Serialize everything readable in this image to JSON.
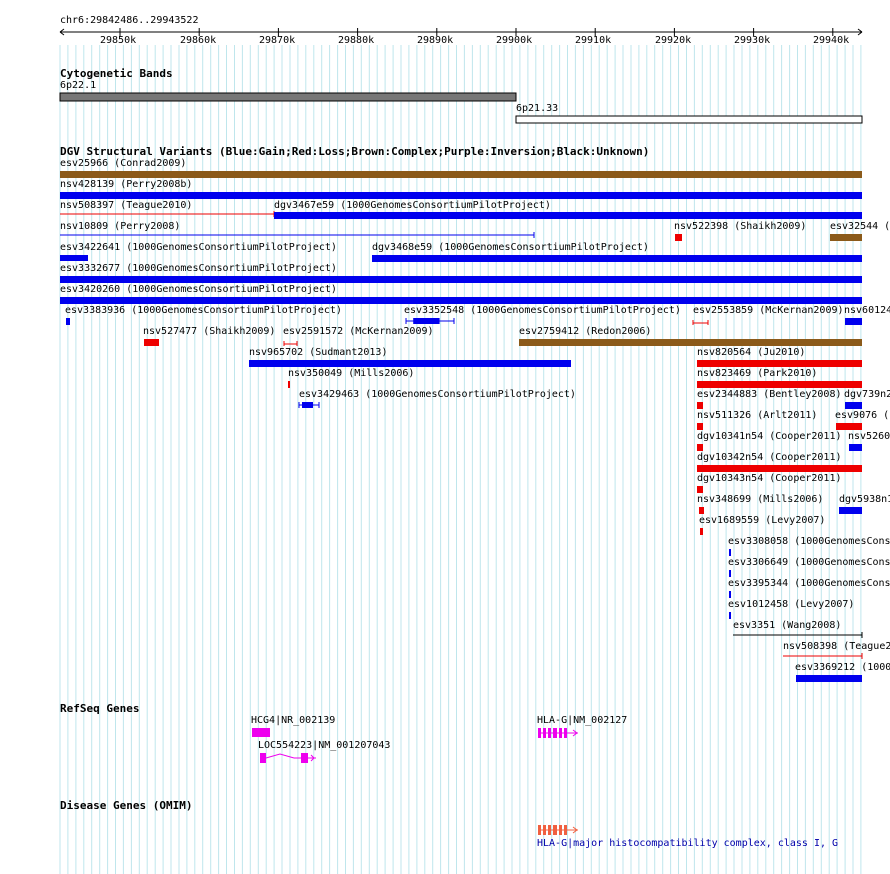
{
  "ruler": {
    "title": "chr6:29842486..29943522",
    "ticks": [
      "29850k",
      "29860k",
      "29870k",
      "29880k",
      "29890k",
      "29900k",
      "29910k",
      "29920k",
      "29930k",
      "29940k"
    ]
  },
  "tracks": {
    "cytoband": "Cytogenetic Bands",
    "dgv": "DGV Structural Variants (Blue:Gain;Red:Loss;Brown:Complex;Purple:Inversion;Black:Unknown)",
    "refseq": "RefSeq Genes",
    "omim": "Disease Genes (OMIM)"
  },
  "cytobands": [
    "6p22.1",
    "6p21.33"
  ],
  "variants": [
    "esv25966 (Conrad2009)",
    "nsv428139 (Perry2008b)",
    "nsv508397 (Teague2010)",
    "dgv3467e59 (1000GenomesConsortiumPilotProject)",
    "nsv10809 (Perry2008)",
    "nsv522398 (Shaikh2009)",
    "esv32544 (",
    "esv3422641 (1000GenomesConsortiumPilotProject)",
    "dgv3468e59 (1000GenomesConsortiumPilotProject)",
    "esv3332677 (1000GenomesConsortiumPilotProject)",
    "esv3420260 (1000GenomesConsortiumPilotProject)",
    "esv3383936 (1000GenomesConsortiumPilotProject)",
    "esv3352548 (1000GenomesConsortiumPilotProject)",
    "esv2553859 (McKernan2009)",
    "nsv60124",
    "nsv527477 (Shaikh2009)",
    "esv2591572 (McKernan2009)",
    "esv2759412 (Redon2006)",
    "nsv965702 (Sudmant2013)",
    "nsv820564 (Ju2010)",
    "nsv350049 (Mills2006)",
    "nsv823469 (Park2010)",
    "esv3429463 (1000GenomesConsortiumPilotProject)",
    "esv2344883 (Bentley2008)",
    "dgv739n2",
    "nsv511326 (Arlt2011)",
    "esv9076 (",
    "dgv10341n54 (Cooper2011)",
    "nsv5260",
    "dgv10342n54 (Cooper2011)",
    "dgv10343n54 (Cooper2011)",
    "nsv348699 (Mills2006)",
    "dgv5938n1",
    "esv1689559 (Levy2007)",
    "esv3308058 (1000GenomesCons",
    "esv3306649 (1000GenomesCons",
    "esv3395344 (1000GenomesCons",
    "esv1012458 (Levy2007)",
    "esv3351 (Wang2008)",
    "nsv508398 (Teague2",
    "esv3369212 (1000"
  ],
  "genes": [
    "HCG4|NR_002139",
    "LOC554223|NM_001207043",
    "HLA-G|NM_002127"
  ],
  "omim": {
    "label": "HLA-G|major histocompatibility complex, class I, G"
  },
  "colors": {
    "grid": "#bfe6ec",
    "gain": "#0000ee",
    "loss": "#ee0000",
    "complex": "#8b5a1a",
    "unknown": "#000000",
    "gene": "#ee00ee",
    "omim_gene": "#f06040",
    "omim_text": "#0000aa"
  }
}
